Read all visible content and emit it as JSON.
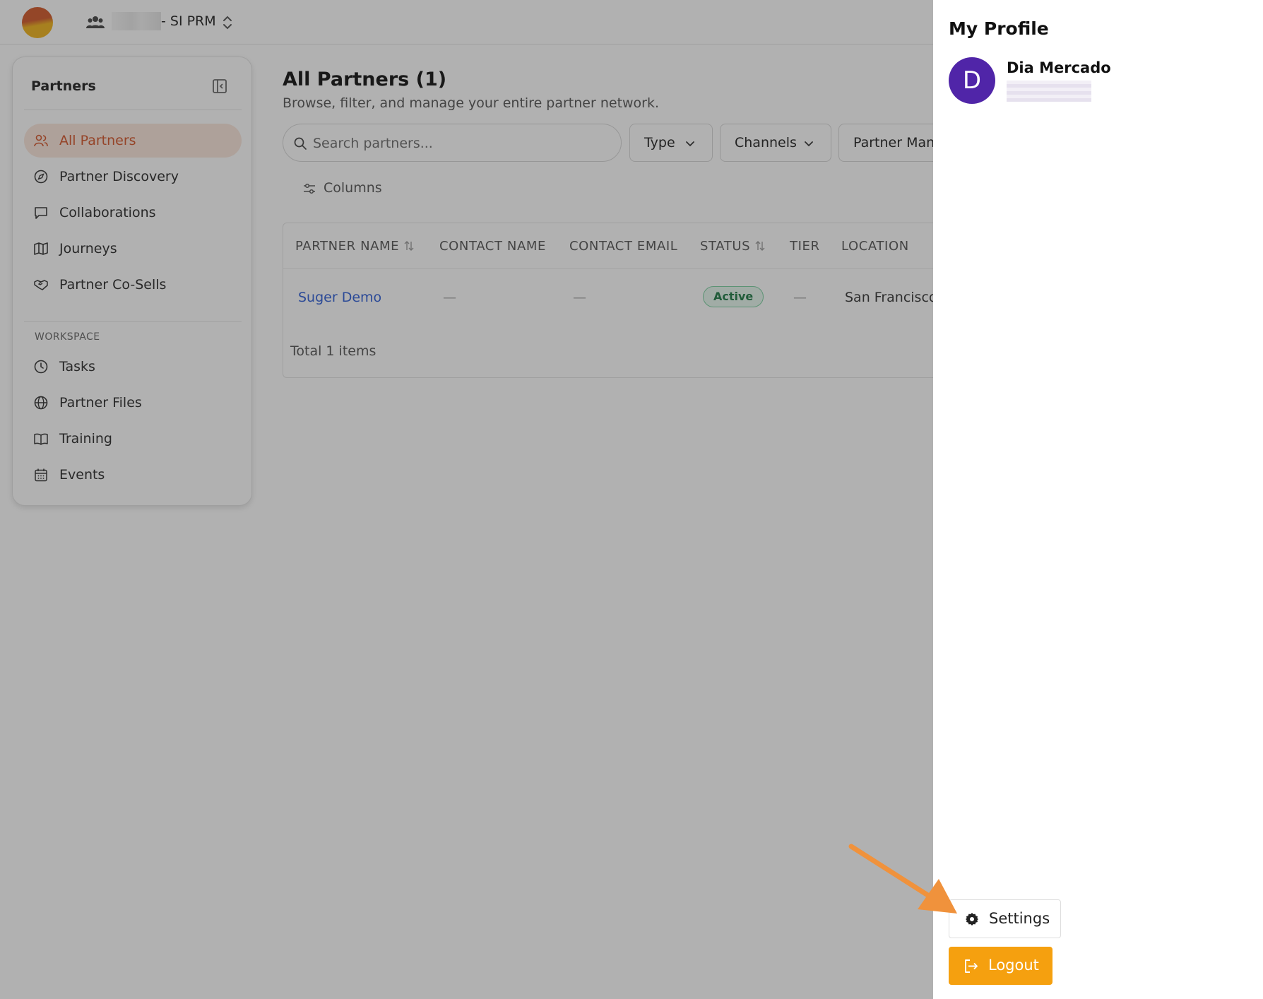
{
  "topbar": {
    "workspace_name": "- SI PRM"
  },
  "sidebar": {
    "title": "Partners",
    "items": [
      {
        "label": "All Partners",
        "icon": "users-icon",
        "active": true
      },
      {
        "label": "Partner Discovery",
        "icon": "compass-icon"
      },
      {
        "label": "Collaborations",
        "icon": "chat-icon"
      },
      {
        "label": "Journeys",
        "icon": "map-icon"
      },
      {
        "label": "Partner Co-Sells",
        "icon": "handshake-icon"
      }
    ],
    "section_label": "WORKSPACE",
    "workspace_items": [
      {
        "label": "Tasks",
        "icon": "clock-icon"
      },
      {
        "label": "Partner Files",
        "icon": "globe-icon"
      },
      {
        "label": "Training",
        "icon": "book-icon"
      },
      {
        "label": "Events",
        "icon": "calendar-icon"
      }
    ]
  },
  "main": {
    "title": "All Partners (1)",
    "subtitle": "Browse, filter, and manage your entire partner network.",
    "search_placeholder": "Search partners...",
    "filters": [
      "Type",
      "Channels",
      "Partner Mana"
    ],
    "columns_label": "Columns",
    "table": {
      "headers": [
        "PARTNER NAME",
        "CONTACT NAME",
        "CONTACT EMAIL",
        "STATUS",
        "TIER",
        "LOCATION"
      ],
      "rows": [
        {
          "partner_name": "Suger Demo",
          "contact_name": "—",
          "contact_email": "—",
          "status": "Active",
          "tier": "—",
          "location": "San Francisco,"
        }
      ],
      "total": "Total 1 items"
    }
  },
  "drawer": {
    "title": "My Profile",
    "avatar_letter": "D",
    "user_name": "Dia Mercado",
    "settings_label": "Settings",
    "logout_label": "Logout"
  },
  "colors": {
    "accent": "#d4552a",
    "active_bg": "#fbe6dc",
    "link": "#2f5fd6",
    "status_active": "#1e7a46",
    "avatar": "#5025a8",
    "logout": "#f5a00f",
    "annotation_arrow": "#f0923c"
  }
}
